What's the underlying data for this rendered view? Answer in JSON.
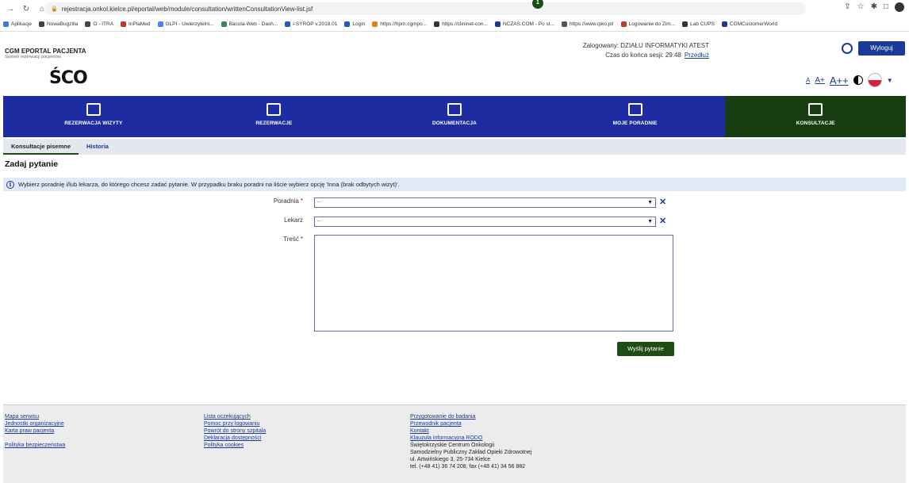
{
  "browser": {
    "url": "rejestracja.onkol.kielce.pl/eportal/web/module/consultation/writtenConsultationView-list.jsf",
    "bookmarks": [
      "Aplikacje",
      "NowaBugzilla",
      "O - ITRA",
      "InPlaMed",
      "GLPI - Uwierzytelni...",
      "Bacula-Web - Dash...",
      "i-SYROP v.2018.01",
      "Login",
      "https://hpm.cgmpo...",
      "https://clininet-con...",
      "NCZAS.COM - Po st...",
      "https://www.ipko.pl/",
      "Logowanie do Zim...",
      "Lab CUPS",
      "CGMCustomerWorld"
    ],
    "bookmark_colors": [
      "#3a7bd5",
      "#444",
      "#444",
      "#c0392b",
      "#4285f4",
      "#2e8b57",
      "#1a5fb4",
      "#1a5fb4",
      "#e67e22",
      "#333",
      "#1a3a9a",
      "#555",
      "#c0392b",
      "#333",
      "#1a3a9a"
    ]
  },
  "header": {
    "app_title": "CGM EPORTAL PACJENTA",
    "app_subtitle": "System rezerwacji pacjentów",
    "logged_label": "Zalogowany:",
    "logged_user": "DZIAŁU INFORMATYKI ATEST",
    "session_label": "Czas do końca sesji:",
    "session_time": "29:48",
    "extend_link": "Przedłuż",
    "logout_label": "Wyloguj",
    "logo_text": "ŚCO",
    "font_small": "A",
    "font_medium": "A+",
    "font_large": "A++"
  },
  "nav": {
    "items": [
      {
        "label": "REZERWACJA WIZYTY",
        "icon": "calendar-check-icon"
      },
      {
        "label": "REZERWACJE",
        "icon": "calendar-7-icon"
      },
      {
        "label": "DOKUMENTACJA",
        "icon": "folder-icon"
      },
      {
        "label": "MOJE PORADNIE",
        "icon": "hospital-icon"
      },
      {
        "label": "KONSULTACJE",
        "icon": "chat-icon"
      }
    ],
    "badge_count": "1"
  },
  "subtabs": {
    "written": "Konsultacje pisemne",
    "history": "Historia"
  },
  "page": {
    "title": "Zadaj pytanie",
    "info": "Wybierz poradnię i/lub lekarza, do którego chcesz zadać pytanie. W przypadku braku poradni na liście wybierz opcję 'Inna (brak odbytych wizyt)'."
  },
  "form": {
    "clinic_label": "Poradnia",
    "clinic_value": "--",
    "doctor_label": "Lekarz",
    "doctor_value": "--",
    "content_label": "Treść",
    "required_mark": "*",
    "submit_label": "Wyślij pytanie"
  },
  "footer": {
    "col1": [
      "Mapa serwisu",
      "Jednostki organizacyjne",
      "Karta praw pacjenta"
    ],
    "col1_extra": "Polityka bezpieczeństwa",
    "col2": [
      "Lista oczekujących",
      "Pomoc przy logowaniu",
      "Powrót do strony szpitala",
      "Deklaracja dostępności",
      "Polityka cookies"
    ],
    "col3_links": [
      "Przygotowanie do badania",
      "Przewodnik pacjenta",
      "Kontakt",
      "Klauzula informacyjna RODO"
    ],
    "col3_text": [
      "Świętokrzyskie Centrum Onkologii",
      "Samodzielny Publiczny Zakład Opieki Zdrowotnej",
      "ul. Artwińskiego 3, 25-734 Kielce",
      "tel. (+48 41) 36 74 208, fax (+48 41) 34 56 882"
    ]
  },
  "colors": {
    "nav_blue": "#1d2ca0",
    "active_green": "#173d10",
    "button_green": "#1e4d14",
    "link_blue": "#1a3a9a",
    "info_bg": "#dfe9f7"
  }
}
